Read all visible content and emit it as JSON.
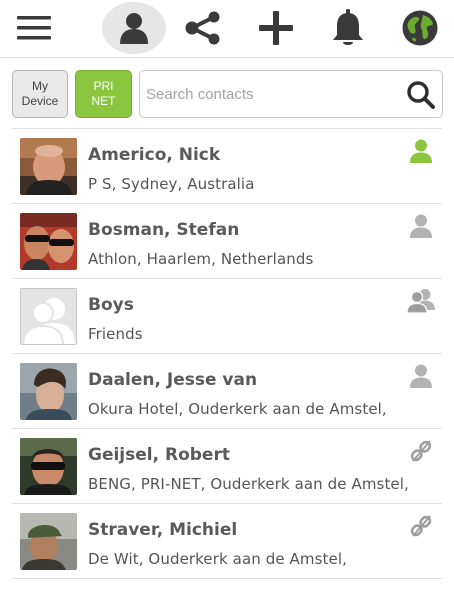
{
  "toolbar": {
    "items": [
      {
        "icon": "menu-icon"
      },
      {
        "icon": "contacts-person-icon",
        "active": true
      },
      {
        "icon": "share-icon"
      },
      {
        "icon": "add-icon"
      },
      {
        "icon": "bell-icon"
      },
      {
        "icon": "globe-icon"
      }
    ],
    "colors": {
      "icon": "#3a3a3a",
      "active_bg": "#e6e6e6",
      "globe": "#6aaa2e"
    }
  },
  "filters": {
    "my_device": "My Device",
    "prinet": "PRI NET",
    "prinet_selected": true,
    "search_placeholder": "Search contacts",
    "search_value": ""
  },
  "colors": {
    "accent": "#8cc63f",
    "online": "#8cc63f",
    "offline": "#b3b3b3"
  },
  "contacts": [
    {
      "name": "Americo, Nick",
      "detail": "P S, Sydney, Australia",
      "status_icon": "person-online-icon",
      "avatar": "photo"
    },
    {
      "name": "Bosman, Stefan",
      "detail": "Athlon, Haarlem, Netherlands",
      "status_icon": "person-offline-icon",
      "avatar": "photo"
    },
    {
      "name": "Boys",
      "detail": "Friends",
      "status_icon": "group-icon",
      "avatar": "placeholder-group"
    },
    {
      "name": "Daalen, Jesse van",
      "detail": "Okura Hotel, Ouderkerk aan de Amstel,",
      "status_icon": "person-offline-icon",
      "avatar": "photo"
    },
    {
      "name": "Geijsel, Robert",
      "detail": "BENG, PRI-NET, Ouderkerk aan de Amstel,",
      "status_icon": "unlinked-icon",
      "avatar": "photo"
    },
    {
      "name": "Straver, Michiel",
      "detail": "De Wit, Ouderkerk aan de Amstel,",
      "status_icon": "unlinked-icon",
      "avatar": "photo"
    }
  ]
}
